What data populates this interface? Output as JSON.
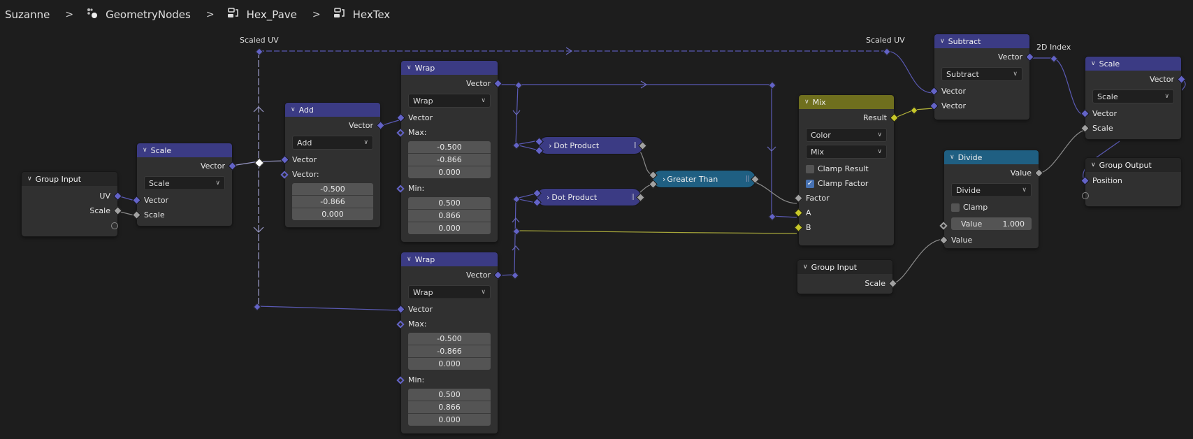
{
  "breadcrumb": {
    "items": [
      {
        "label": "Suzanne",
        "icon": "object"
      },
      {
        "label": "GeometryNodes",
        "icon": "geometry-nodes-modifier-icon"
      },
      {
        "label": "Hex_Pave",
        "icon": "node-tree-icon"
      },
      {
        "label": "HexTex",
        "icon": "node-tree-icon"
      }
    ],
    "separator": ">"
  },
  "labels": {
    "scaled_uv_1": "Scaled UV",
    "scaled_uv_2": "Scaled UV",
    "index_2d": "2D Index"
  },
  "nodes": {
    "group_input_1": {
      "title": "Group Input",
      "outputs": [
        "UV",
        "Scale"
      ]
    },
    "scale_1": {
      "title": "Scale",
      "output": "Vector",
      "mode": "Scale",
      "inputs": [
        "Vector",
        "Scale"
      ]
    },
    "add": {
      "title": "Add",
      "output": "Vector",
      "mode": "Add",
      "input_vector": "Vector",
      "vector_label": "Vector:",
      "values": [
        "-0.500",
        "-0.866",
        "0.000"
      ]
    },
    "wrap_1": {
      "title": "Wrap",
      "output": "Vector",
      "mode": "Wrap",
      "input_vector": "Vector",
      "max_label": "Max:",
      "max": [
        "-0.500",
        "-0.866",
        "0.000"
      ],
      "min_label": "Min:",
      "min": [
        "0.500",
        "0.866",
        "0.000"
      ]
    },
    "wrap_2": {
      "title": "Wrap",
      "output": "Vector",
      "mode": "Wrap",
      "input_vector": "Vector",
      "max_label": "Max:",
      "max": [
        "-0.500",
        "-0.866",
        "0.000"
      ],
      "min_label": "Min:",
      "min": [
        "0.500",
        "0.866",
        "0.000"
      ]
    },
    "dot_1": {
      "title": "Dot Product"
    },
    "dot_2": {
      "title": "Dot Product"
    },
    "greater_than": {
      "title": "Greater Than"
    },
    "mix": {
      "title": "Mix",
      "output": "Result",
      "data_type": "Color",
      "blend": "Mix",
      "clamp_result": "Clamp Result",
      "clamp_result_checked": false,
      "clamp_factor": "Clamp Factor",
      "clamp_factor_checked": true,
      "inputs": [
        "Factor",
        "A",
        "B"
      ]
    },
    "group_input_2": {
      "title": "Group Input",
      "output": "Scale"
    },
    "subtract": {
      "title": "Subtract",
      "output": "Vector",
      "mode": "Subtract",
      "inputs": [
        "Vector",
        "Vector"
      ]
    },
    "divide": {
      "title": "Divide",
      "output": "Value",
      "mode": "Divide",
      "clamp": "Clamp",
      "clamp_checked": false,
      "value_label": "Value",
      "value": "1.000",
      "input": "Value"
    },
    "scale_2": {
      "title": "Scale",
      "output": "Vector",
      "mode": "Scale",
      "inputs": [
        "Vector",
        "Scale"
      ]
    },
    "group_output": {
      "title": "Group Output",
      "input": "Position"
    }
  },
  "colors": {
    "vector_header": "#3b3b84",
    "mix_header": "#6f6f1e",
    "math_header": "#1f5f82",
    "vector_socket": "#6363c7",
    "float_socket": "#a1a1a1",
    "color_socket": "#c7c729",
    "background": "#1d1d1d",
    "node_body": "#303030"
  }
}
